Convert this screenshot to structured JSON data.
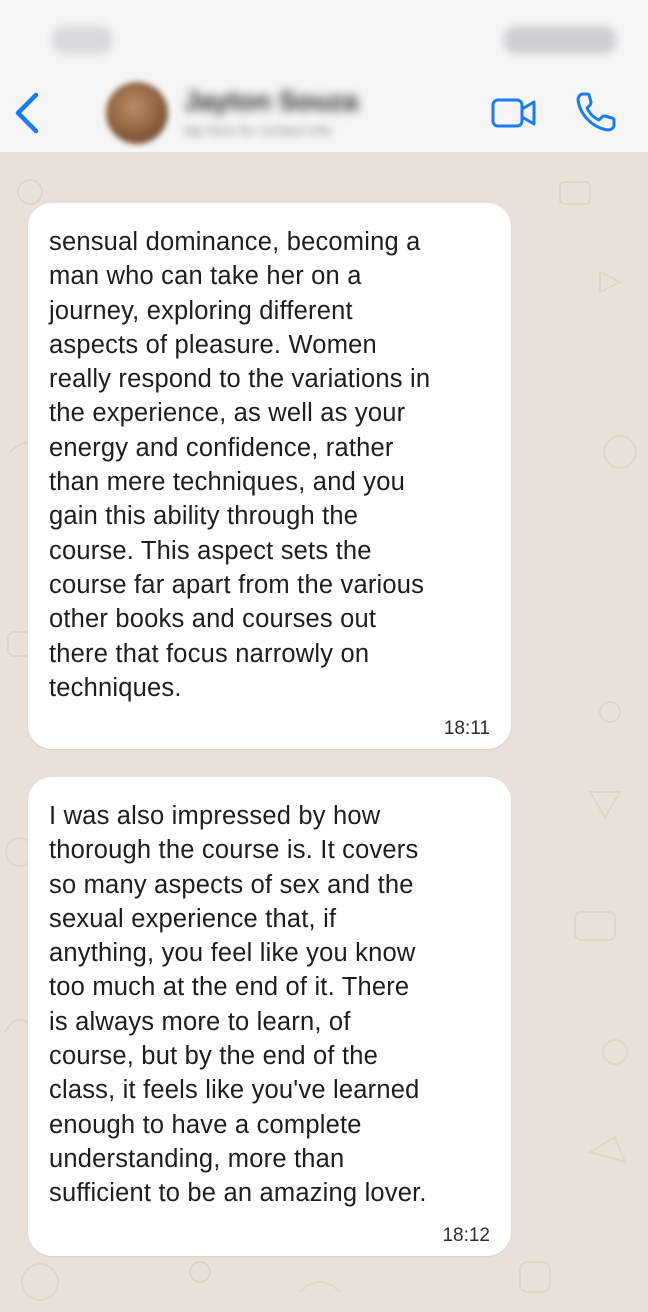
{
  "header": {
    "contact_name": "Jayton Souza",
    "contact_subtitle": "tap here for contact info",
    "status_time": "9:41",
    "status_icons": "signal wifi battery",
    "back_icon": "chevron-left-icon",
    "video_icon": "video-camera-icon",
    "call_icon": "phone-icon",
    "accent_color": "#1a7cf0"
  },
  "messages": [
    {
      "text": "sensual dominance, becoming a\nman who can take her on a\njourney, exploring different\naspects of pleasure. Women\nreally respond to the variations in\nthe experience, as well as your\nenergy and confidence, rather\nthan mere techniques, and you\ngain this ability through the\ncourse. This aspect sets the\ncourse far apart from the various\nother books and courses out\nthere that focus narrowly on\ntechniques.",
      "time": "18:11"
    },
    {
      "text": "I was also impressed by how\nthorough the course is. It covers\nso many aspects of sex and the\nsexual experience that, if\nanything, you feel like you know\ntoo much at the end of it. There\nis always more to learn, of\ncourse, but by the end of the\nclass, it feels like you've learned\nenough to have a complete\nunderstanding, more than\nsufficient to be an amazing lover.",
      "time": "18:12"
    }
  ],
  "colors": {
    "chat_background": "#e9e1d9",
    "bubble_incoming": "#ffffff",
    "header_background": "#f6f6f7"
  }
}
